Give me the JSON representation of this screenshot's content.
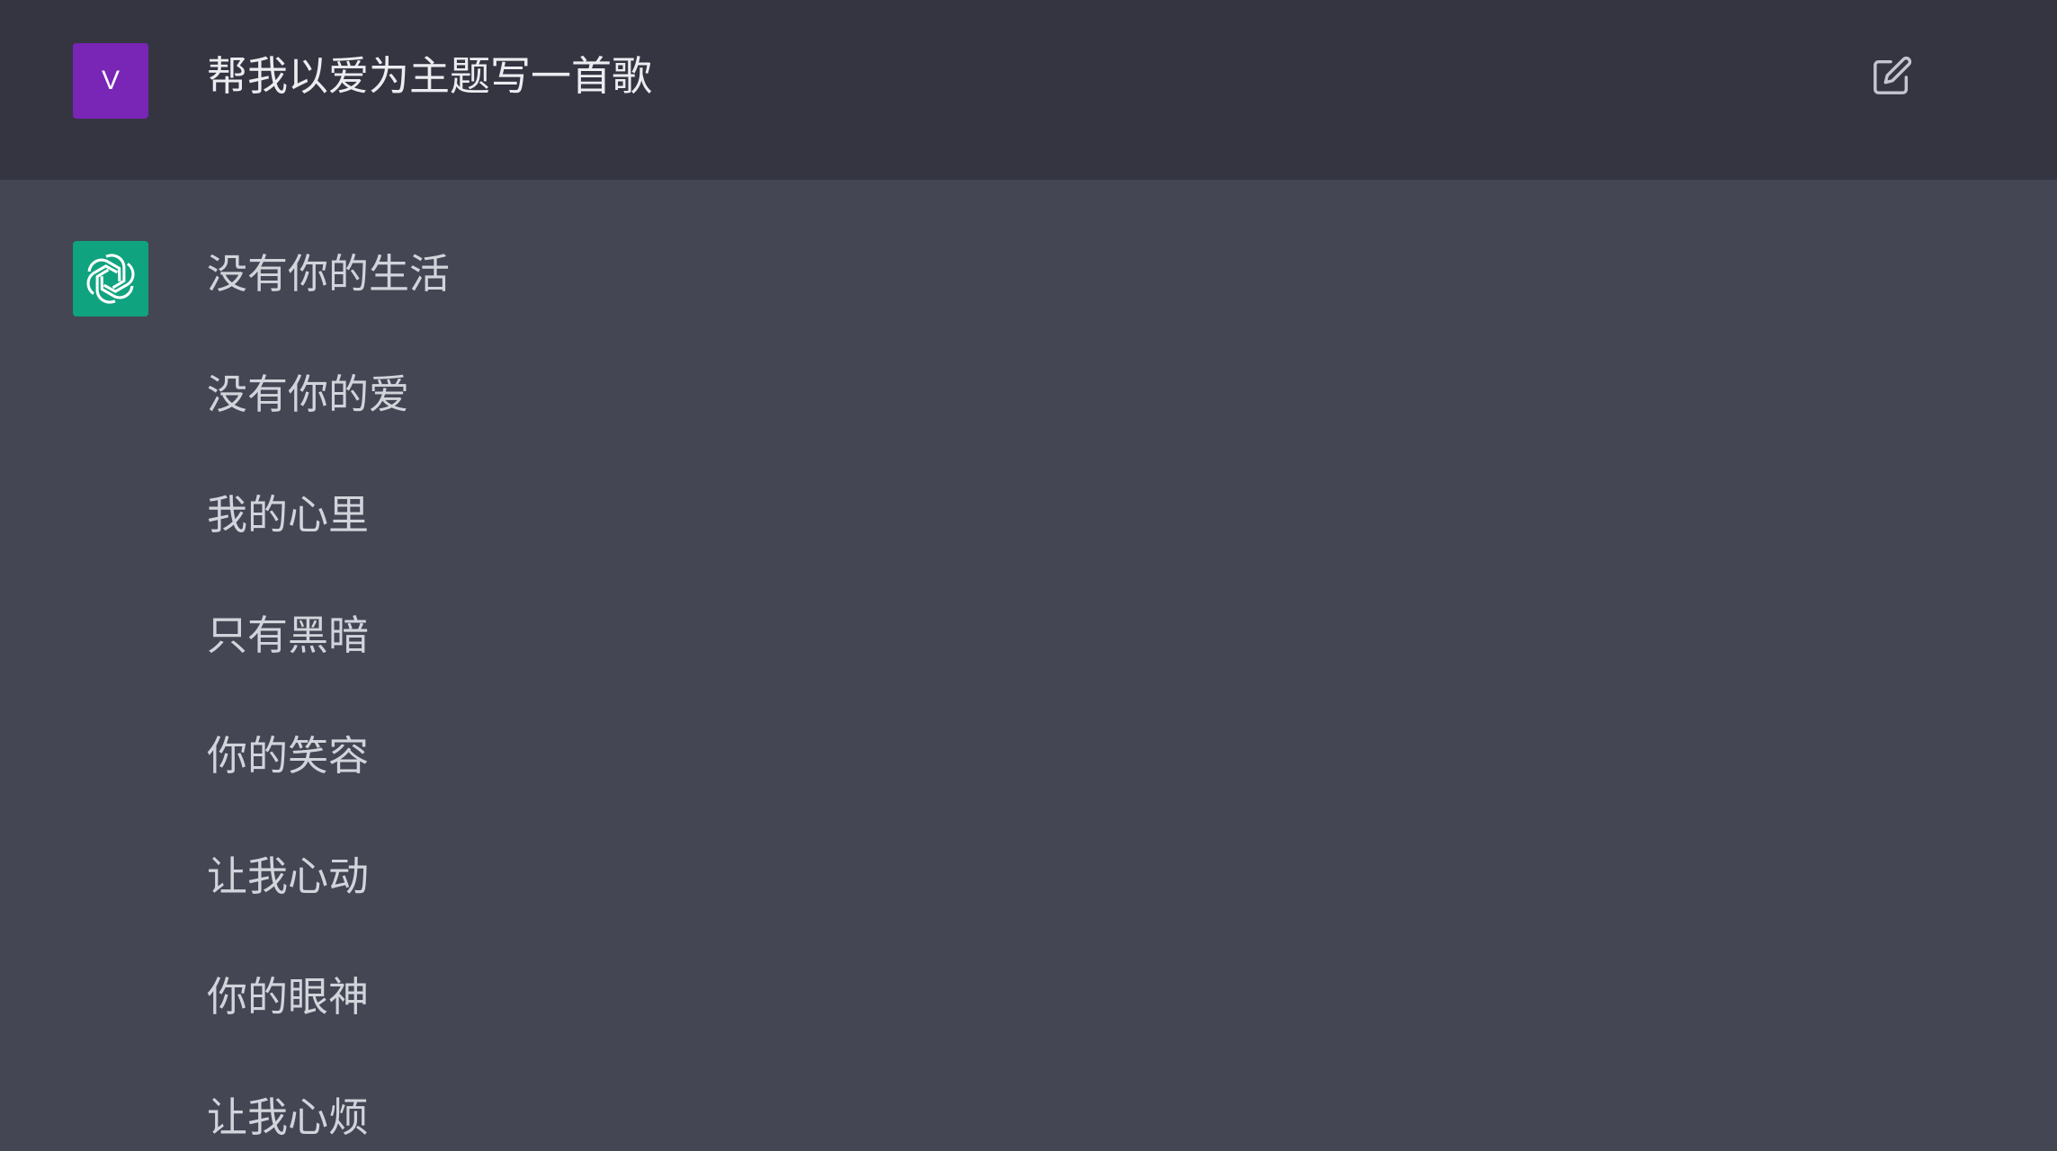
{
  "colors": {
    "user_bg": "#343541",
    "assistant_bg": "#444654",
    "user_avatar": "#7925b6",
    "assistant_avatar": "#10a37f"
  },
  "user_message": {
    "avatar_letter": "V",
    "text": "帮我以爱为主题写一首歌",
    "edit_icon": "edit-icon"
  },
  "assistant_message": {
    "avatar_icon": "openai-logo-icon",
    "lines": [
      "没有你的生活",
      "没有你的爱",
      "我的心里",
      "只有黑暗",
      "你的笑容",
      "让我心动",
      "你的眼神",
      "让我心烦"
    ]
  }
}
